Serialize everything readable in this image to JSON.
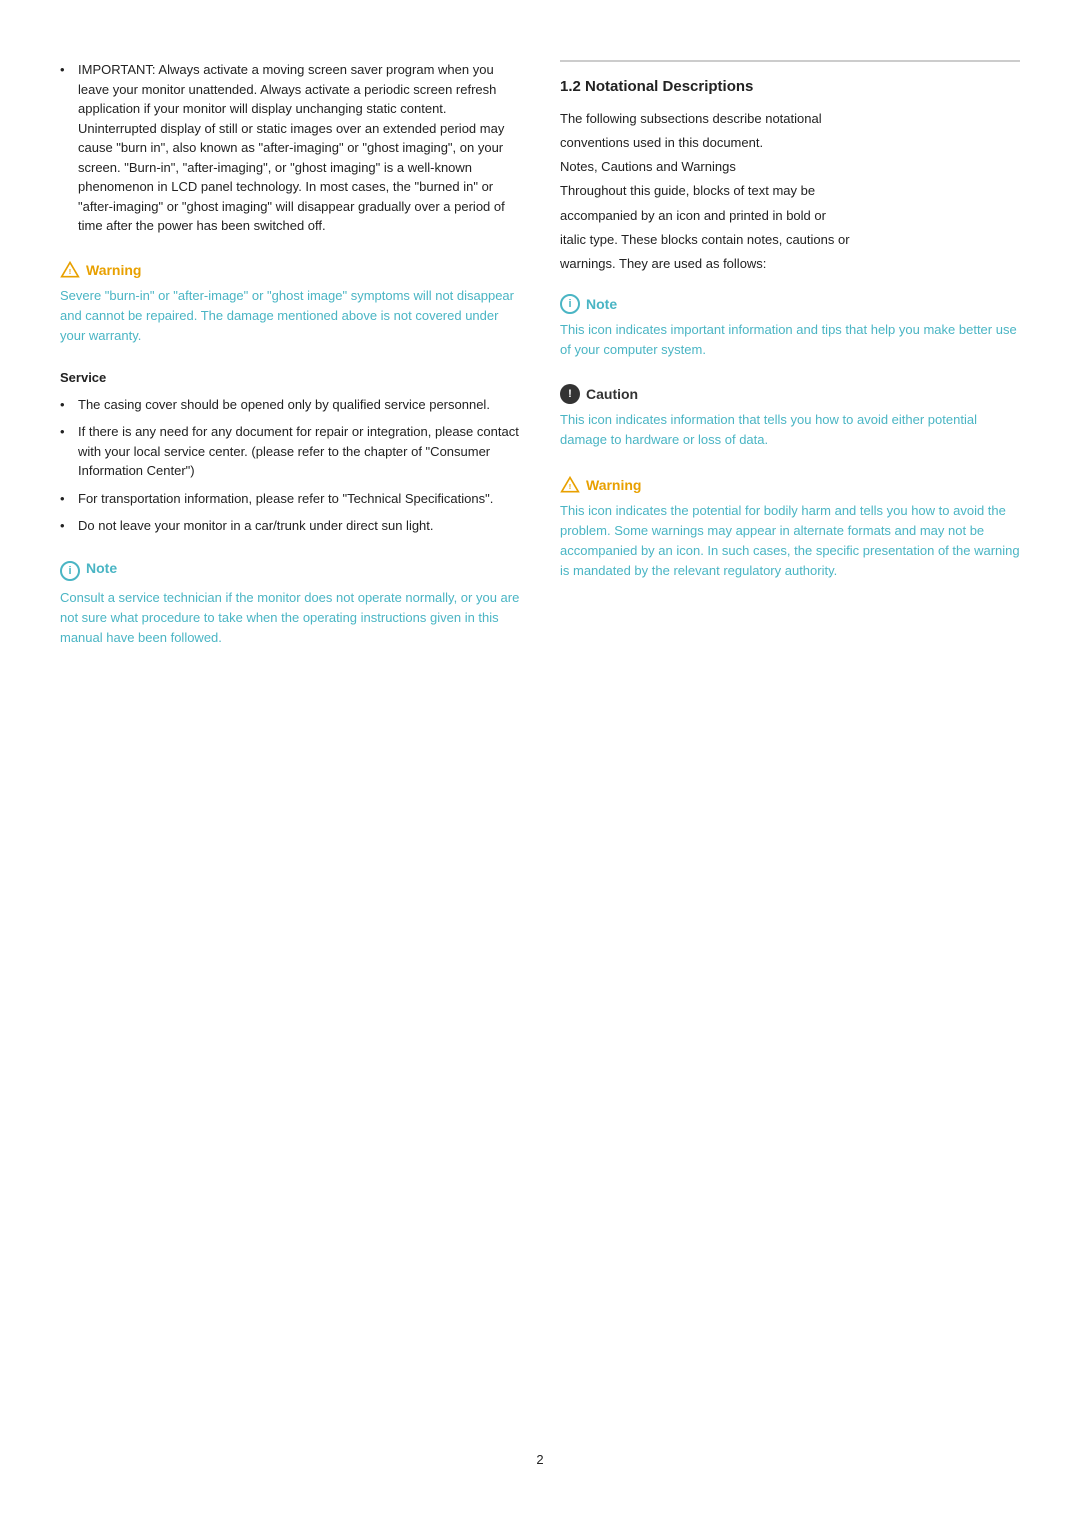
{
  "left": {
    "intro_bullets": [
      "IMPORTANT: Always activate a moving screen saver program when you leave your monitor unattended. Always activate a periodic screen refresh application if your monitor will display unchanging static content. Uninterrupted display of still or static images over an extended period may cause \"burn in\", also known as \"after-imaging\" or \"ghost imaging\", on your screen. \"Burn-in\", \"after-imaging\", or \"ghost imaging\" is a well-known phenomenon in LCD panel technology. In most cases, the \"burned in\" or \"after-imaging\" or \"ghost imaging\" will disappear gradually over a period of time after the power has been switched off."
    ],
    "warning1": {
      "label": "Warning",
      "text": "Severe \"burn-in\" or \"after-image\" or \"ghost image\" symptoms will not disappear and cannot be repaired. The damage mentioned above is not covered under your warranty."
    },
    "service_heading": "Service",
    "service_bullets": [
      "The casing cover should be opened only by qualified service personnel.",
      "If there is any need for any document for repair or integration, please contact with your local service center. (please refer to the chapter of \"Consumer Information Center\")",
      "For transportation information, please refer to \"Technical Specifications\".",
      "Do not leave your monitor in a car/trunk under direct sun light."
    ],
    "note1": {
      "label": "Note",
      "text": "Consult a service technician if the monitor does not operate normally, or you are not sure what procedure to take when the operating instructions given in this manual have been followed."
    }
  },
  "right": {
    "section_title": "1.2 Notational Descriptions",
    "intro_line1": "The following subsections describe notational",
    "intro_line2": "conventions used in this document.",
    "intro_line3": "Notes, Cautions and Warnings",
    "intro_line4": "Throughout this guide, blocks of text may be",
    "intro_line5": "accompanied by an icon and printed in bold or",
    "intro_line6": "italic type. These blocks contain notes, cautions or",
    "intro_line7": "warnings. They are used as follows:",
    "note_section": {
      "label": "Note",
      "text": "This icon indicates important information and tips that help you make better use of your computer system."
    },
    "caution_section": {
      "label": "Caution",
      "text": "This icon indicates information that tells you how to avoid either potential damage to hardware or loss of data."
    },
    "warning_section": {
      "label": "Warning",
      "text": "This icon indicates the potential for bodily harm and tells you how to avoid the problem. Some warnings may appear in alternate formats and may not be accompanied by an icon. In such cases, the specific presentation of the warning is mandated by the relevant regulatory authority."
    }
  },
  "page_number": "2"
}
